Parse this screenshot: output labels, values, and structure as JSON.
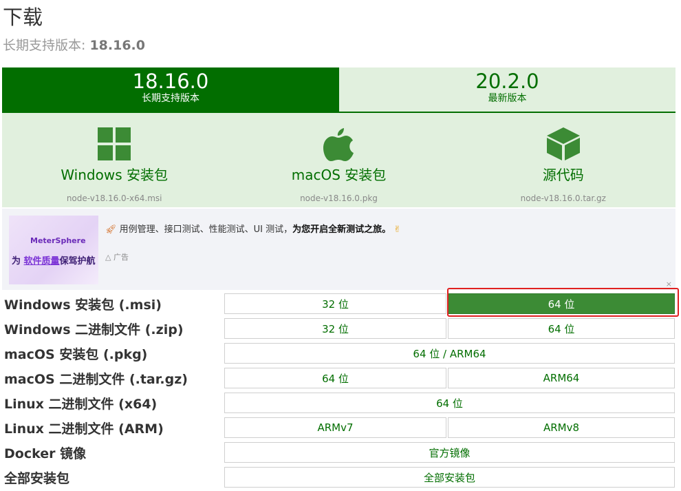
{
  "header": {
    "title": "下载",
    "subtitle_prefix": "长期支持版本:",
    "subtitle_version": "18.16.0"
  },
  "tabs": [
    {
      "version": "18.16.0",
      "label": "长期支持版本",
      "active": true
    },
    {
      "version": "20.2.0",
      "label": "最新版本",
      "active": false
    }
  ],
  "cards": [
    {
      "icon": "windows-icon",
      "title": "Windows 安装包",
      "file": "node-v18.16.0-x64.msi"
    },
    {
      "icon": "apple-icon",
      "title": "macOS 安装包",
      "file": "node-v18.16.0.pkg"
    },
    {
      "icon": "box-icon",
      "title": "源代码",
      "file": "node-v18.16.0.tar.gz"
    }
  ],
  "ad": {
    "image_brand": "MeterSphere",
    "image_slogan_a": "为 ",
    "image_slogan_b": "软件质量",
    "image_slogan_c": "保驾护航",
    "text_prefix": "用例管理、接口测试、性能测试、UI 测试，",
    "text_bold": "为您开启全新测试之旅。",
    "label": "广告",
    "close": "×"
  },
  "downloads": [
    {
      "label": "Windows 安装包 (.msi)",
      "cells": [
        "32 位",
        "64 位"
      ]
    },
    {
      "label": "Windows 二进制文件 (.zip)",
      "cells": [
        "32 位",
        "64 位"
      ]
    },
    {
      "label": "macOS 安装包 (.pkg)",
      "cells": [
        "64 位 / ARM64"
      ]
    },
    {
      "label": "macOS 二进制文件 (.tar.gz)",
      "cells": [
        "64 位",
        "ARM64"
      ]
    },
    {
      "label": "Linux 二进制文件 (x64)",
      "cells": [
        "64 位"
      ]
    },
    {
      "label": "Linux 二进制文件 (ARM)",
      "cells": [
        "ARMv7",
        "ARMv8"
      ]
    },
    {
      "label": "Docker 镜像",
      "cells": [
        "官方镜像"
      ]
    },
    {
      "label": "全部安装包",
      "cells": [
        "全部安装包"
      ]
    }
  ],
  "colors": {
    "brand_green": "#026e00",
    "light_green": "#e1f0de",
    "active_cell": "#3c8b35",
    "highlight_red": "#e02020"
  }
}
